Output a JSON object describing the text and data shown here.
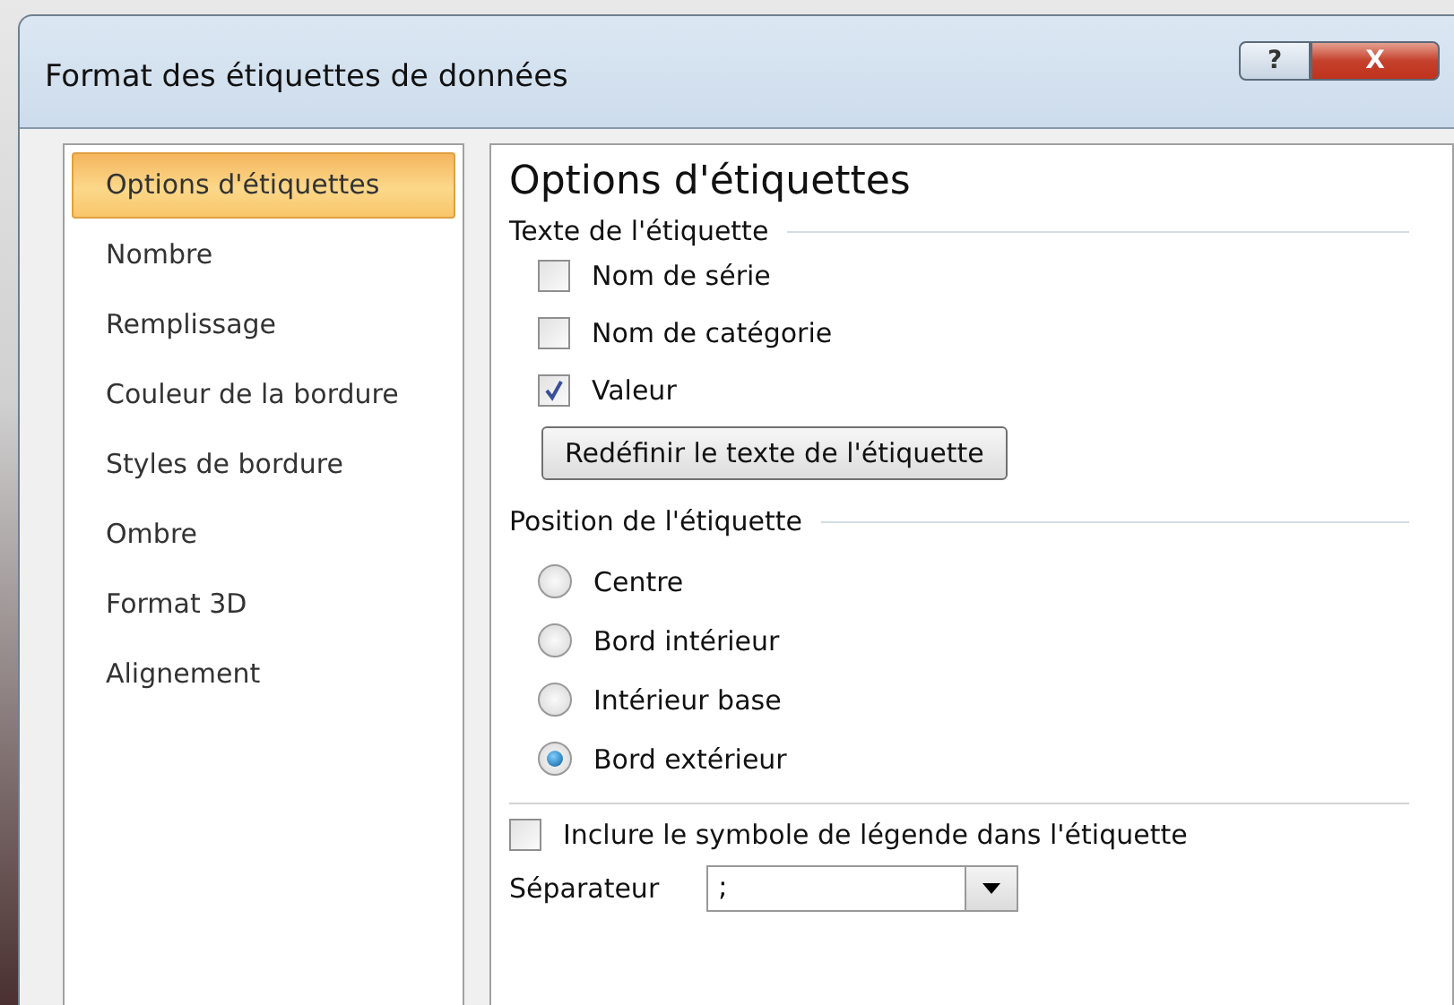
{
  "window": {
    "title": "Format des étiquettes de données",
    "help_button": "?",
    "close_button": "X"
  },
  "sidebar": {
    "items": [
      {
        "label": "Options d'étiquettes",
        "selected": true
      },
      {
        "label": "Nombre",
        "selected": false
      },
      {
        "label": "Remplissage",
        "selected": false
      },
      {
        "label": "Couleur de la bordure",
        "selected": false
      },
      {
        "label": "Styles de bordure",
        "selected": false
      },
      {
        "label": "Ombre",
        "selected": false
      },
      {
        "label": "Format 3D",
        "selected": false
      },
      {
        "label": "Alignement",
        "selected": false
      }
    ]
  },
  "panel": {
    "title": "Options d'étiquettes",
    "label_text": {
      "heading": "Texte de l'étiquette",
      "options": [
        {
          "label": "Nom de série",
          "checked": false
        },
        {
          "label": "Nom de catégorie",
          "checked": false
        },
        {
          "label": "Valeur",
          "checked": true
        }
      ],
      "reset_button": "Redéfinir le texte de l'étiquette"
    },
    "label_position": {
      "heading": "Position de l'étiquette",
      "options": [
        {
          "label": "Centre",
          "selected": false
        },
        {
          "label": "Bord intérieur",
          "selected": false
        },
        {
          "label": "Intérieur base",
          "selected": false
        },
        {
          "label": "Bord extérieur",
          "selected": true
        }
      ]
    },
    "include_legend_key": {
      "label": "Inclure le symbole de légende dans l'étiquette",
      "checked": false
    },
    "separator": {
      "label": "Séparateur",
      "value": ";"
    }
  }
}
